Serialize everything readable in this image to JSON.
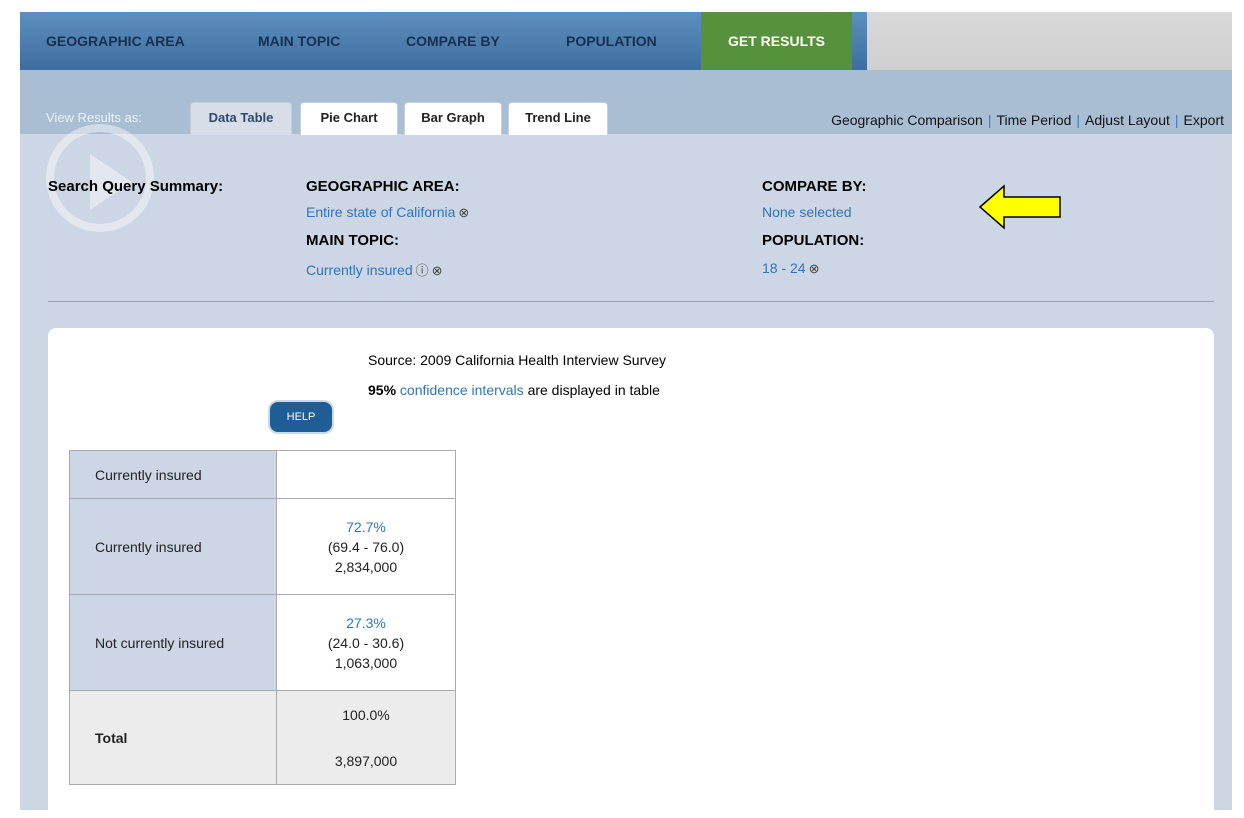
{
  "steps": [
    "GEOGRAPHIC AREA",
    "MAIN TOPIC",
    "COMPARE BY",
    "POPULATION",
    "GET RESULTS"
  ],
  "view_label": "View Results as:",
  "tabs": [
    "Data Table",
    "Pie Chart",
    "Bar Graph",
    "Trend Line"
  ],
  "right_links": [
    "Geographic Comparison",
    "Time Period",
    "Adjust Layout",
    "Export"
  ],
  "summary": {
    "title": "Search Query Summary:",
    "geo_label": "GEOGRAPHIC AREA:",
    "geo_value": "Entire state of California",
    "topic_label": "MAIN TOPIC:",
    "topic_value": "Currently insured",
    "compare_label": "COMPARE BY:",
    "compare_value": "None selected",
    "pop_label": "POPULATION:",
    "pop_value": "18 - 24"
  },
  "source": "Source: 2009 California Health Interview Survey",
  "ci": {
    "pct": "95%",
    "link": "confidence intervals",
    "rest": "are displayed in table"
  },
  "help_label": "HELP",
  "table": {
    "header_label": "Currently insured",
    "rows": [
      {
        "label": "Currently insured",
        "pct": "72.7%",
        "ci": "(69.4 - 76.0)",
        "count": "2,834,000"
      },
      {
        "label": "Not currently insured",
        "pct": "27.3%",
        "ci": "(24.0 - 30.6)",
        "count": "1,063,000"
      }
    ],
    "total": {
      "label": "Total",
      "pct": "100.0%",
      "count": "3,897,000"
    }
  },
  "colors": {
    "nav_blue": "#4a7daf",
    "active_green": "#56923b",
    "link_blue": "#2f74c0",
    "arrow_yellow": "#ffff00"
  }
}
